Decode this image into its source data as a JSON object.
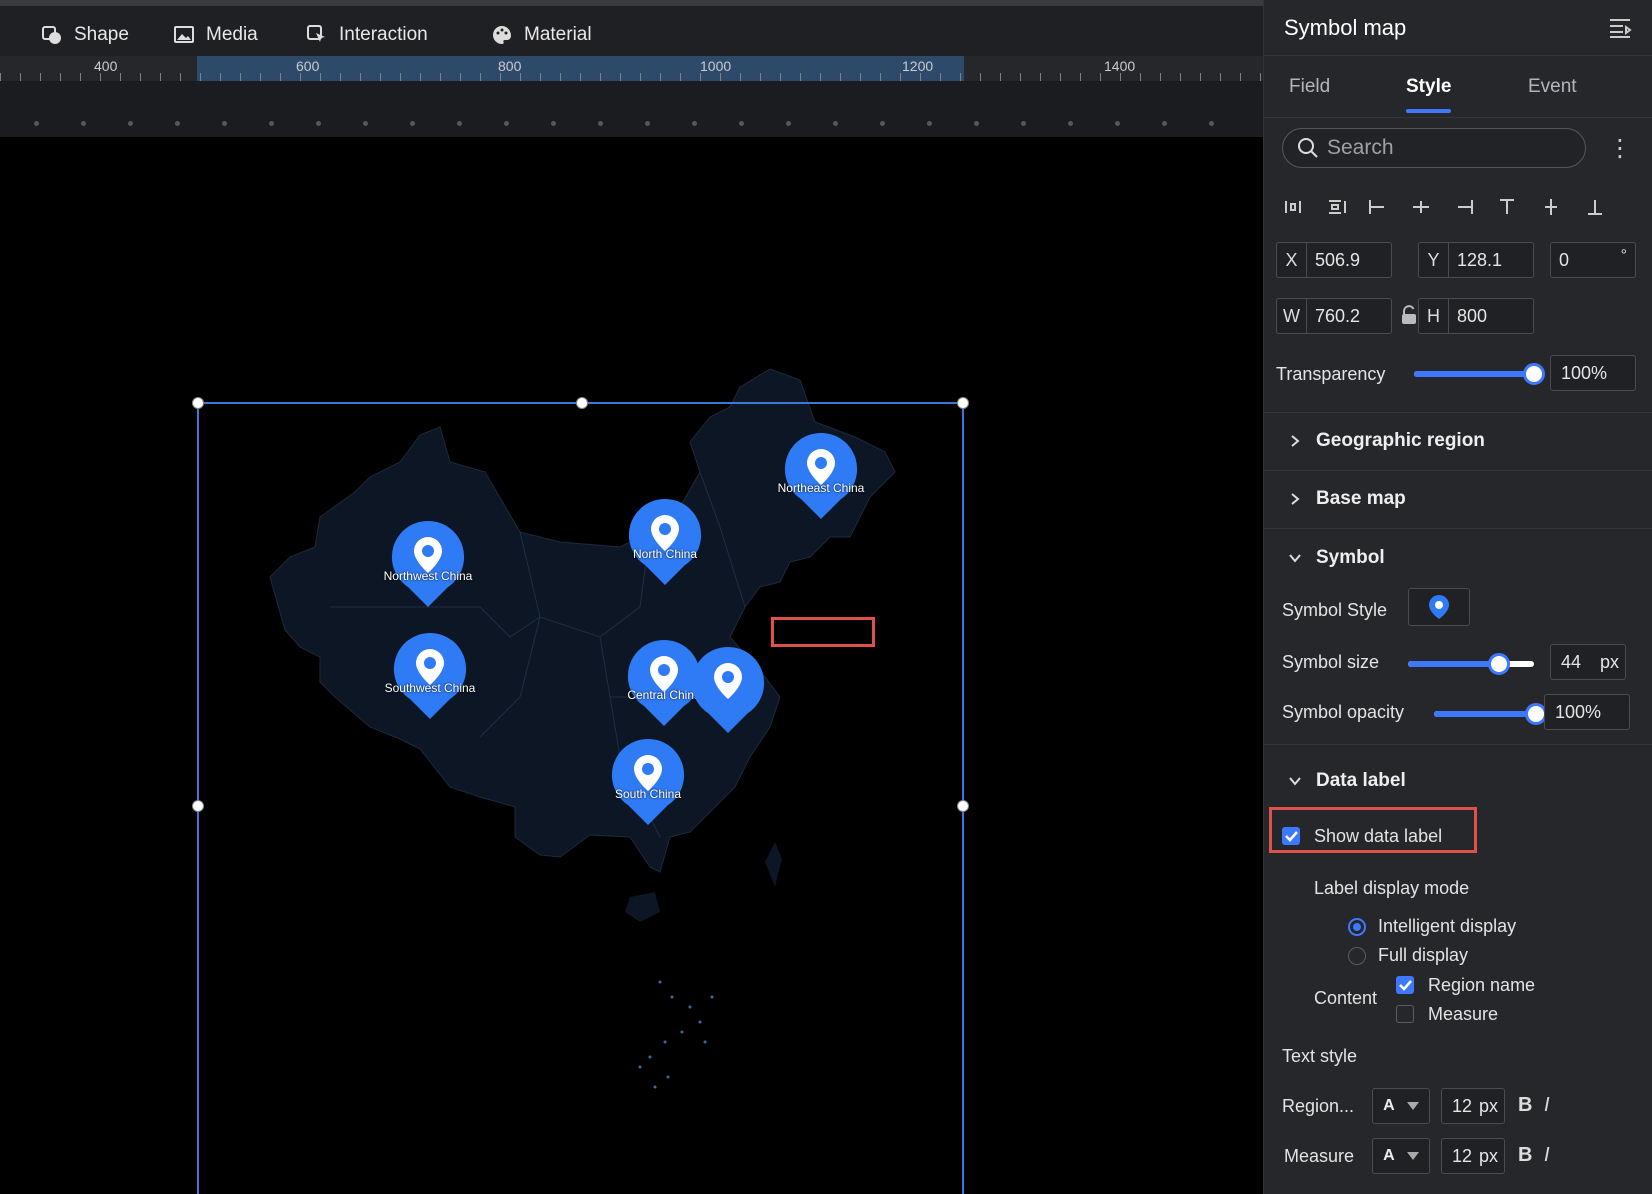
{
  "toolbar": {
    "items": [
      {
        "label": "Shape",
        "icon": "shape-icon"
      },
      {
        "label": "Media",
        "icon": "image-icon"
      },
      {
        "label": "Interaction",
        "icon": "interaction-icon"
      },
      {
        "label": "Material",
        "icon": "palette-icon"
      }
    ]
  },
  "ruler": {
    "labels": [
      "400",
      "600",
      "800",
      "1000",
      "1200",
      "1400"
    ]
  },
  "map": {
    "regions": [
      {
        "name": "Northeast China"
      },
      {
        "name": "North China"
      },
      {
        "name": "Northwest China"
      },
      {
        "name": "Southwest China"
      },
      {
        "name": "Central China"
      },
      {
        "name": "South China"
      }
    ]
  },
  "panel": {
    "title": "Symbol map",
    "tabs": [
      "Field",
      "Style",
      "Event"
    ],
    "active_tab": "Style",
    "search_placeholder": "Search",
    "more_icon": "⋮",
    "x_label": "X",
    "x_value": "506.9",
    "y_label": "Y",
    "y_value": "128.1",
    "rotation_value": "0",
    "rotation_unit": "°",
    "w_label": "W",
    "w_value": "760.2",
    "h_label": "H",
    "h_value": "800",
    "transparency_label": "Transparency",
    "transparency_value": "100%",
    "transparency": 1.0,
    "sections": {
      "geographic_region": "Geographic region",
      "base_map": "Base map",
      "symbol": "Symbol",
      "data_label": "Data label"
    },
    "symbol_style_label": "Symbol Style",
    "symbol_size_label": "Symbol size",
    "symbol_size_value": "44",
    "symbol_size_unit": "px",
    "symbol_size_fraction": 0.72,
    "symbol_opacity_label": "Symbol opacity",
    "symbol_opacity_value": "100%",
    "symbol_opacity": 1.0,
    "show_data_label": "Show data label",
    "label_display_mode": "Label display mode",
    "mode_intelligent": "Intelligent display",
    "mode_full": "Full display",
    "content_label": "Content",
    "content_region_name": "Region name",
    "content_measure": "Measure",
    "text_style_label": "Text style",
    "region_label": "Region...",
    "measure_label": "Measure",
    "font_glyph": "A",
    "region_font_size": "12",
    "measure_font_size": "12",
    "font_unit": "px",
    "bold": "B",
    "italic": "I"
  },
  "colors": {
    "accent": "#3d78ff",
    "pin": "#2f7bf5",
    "highlight": "#e0514a",
    "map_fill": "#0c1624"
  }
}
